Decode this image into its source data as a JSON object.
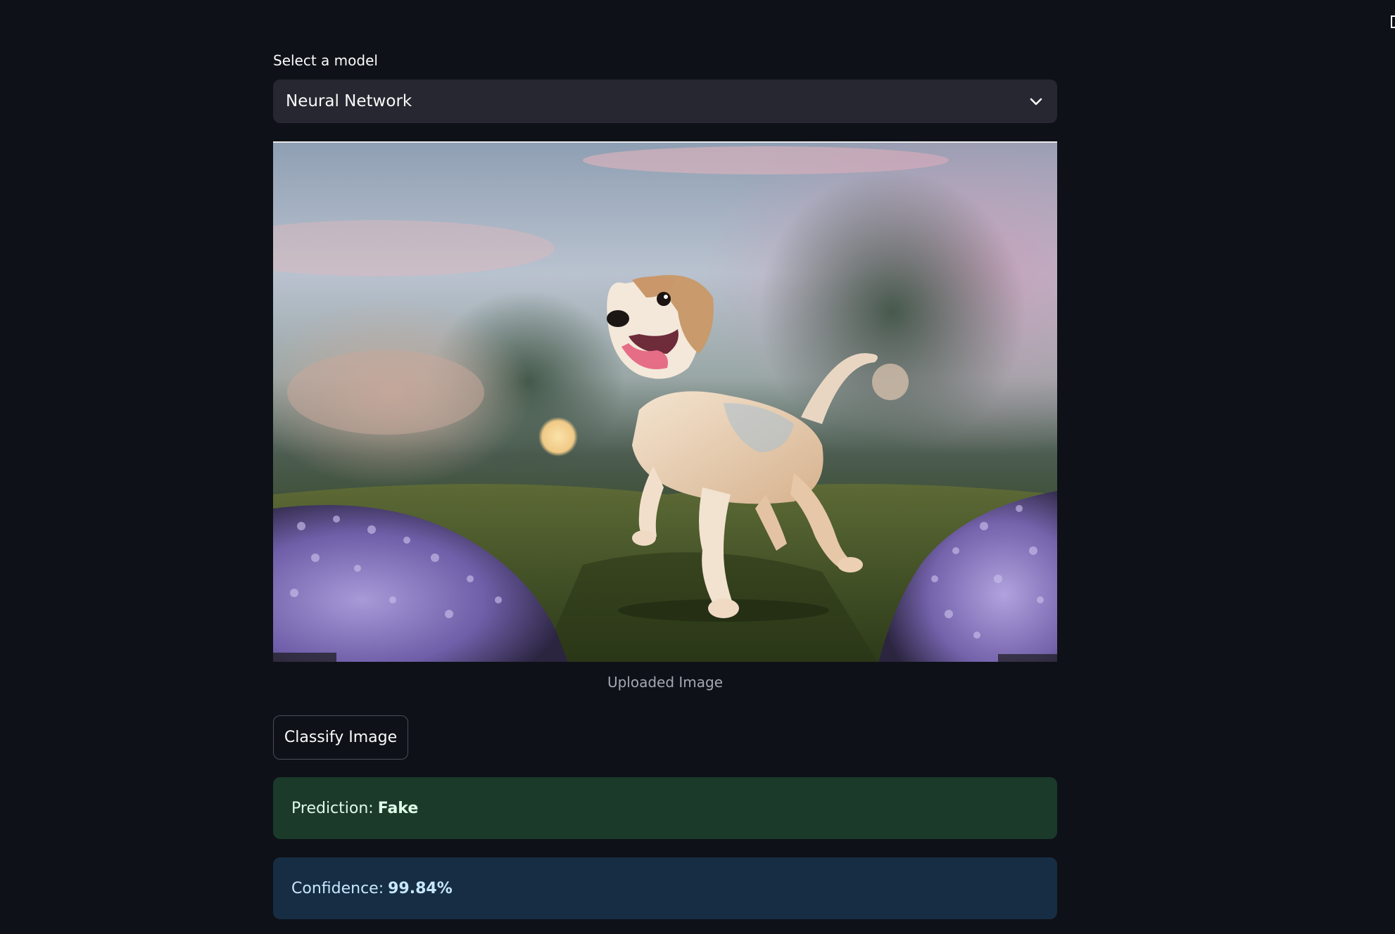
{
  "model_select": {
    "label": "Select a model",
    "selected": "Neural Network",
    "icon": "chevron-down-icon"
  },
  "image": {
    "caption": "Uploaded Image",
    "subject": "beagle-running-in-flower-meadow"
  },
  "classify_button": {
    "label": "Classify Image"
  },
  "prediction": {
    "label": "Prediction:",
    "value": "Fake"
  },
  "confidence": {
    "label": "Confidence:",
    "value": "99.84%"
  },
  "colors": {
    "background": "#0e1117",
    "select_bg": "#262730",
    "success_bg": "#1b3a2a",
    "info_bg": "#172d43"
  }
}
